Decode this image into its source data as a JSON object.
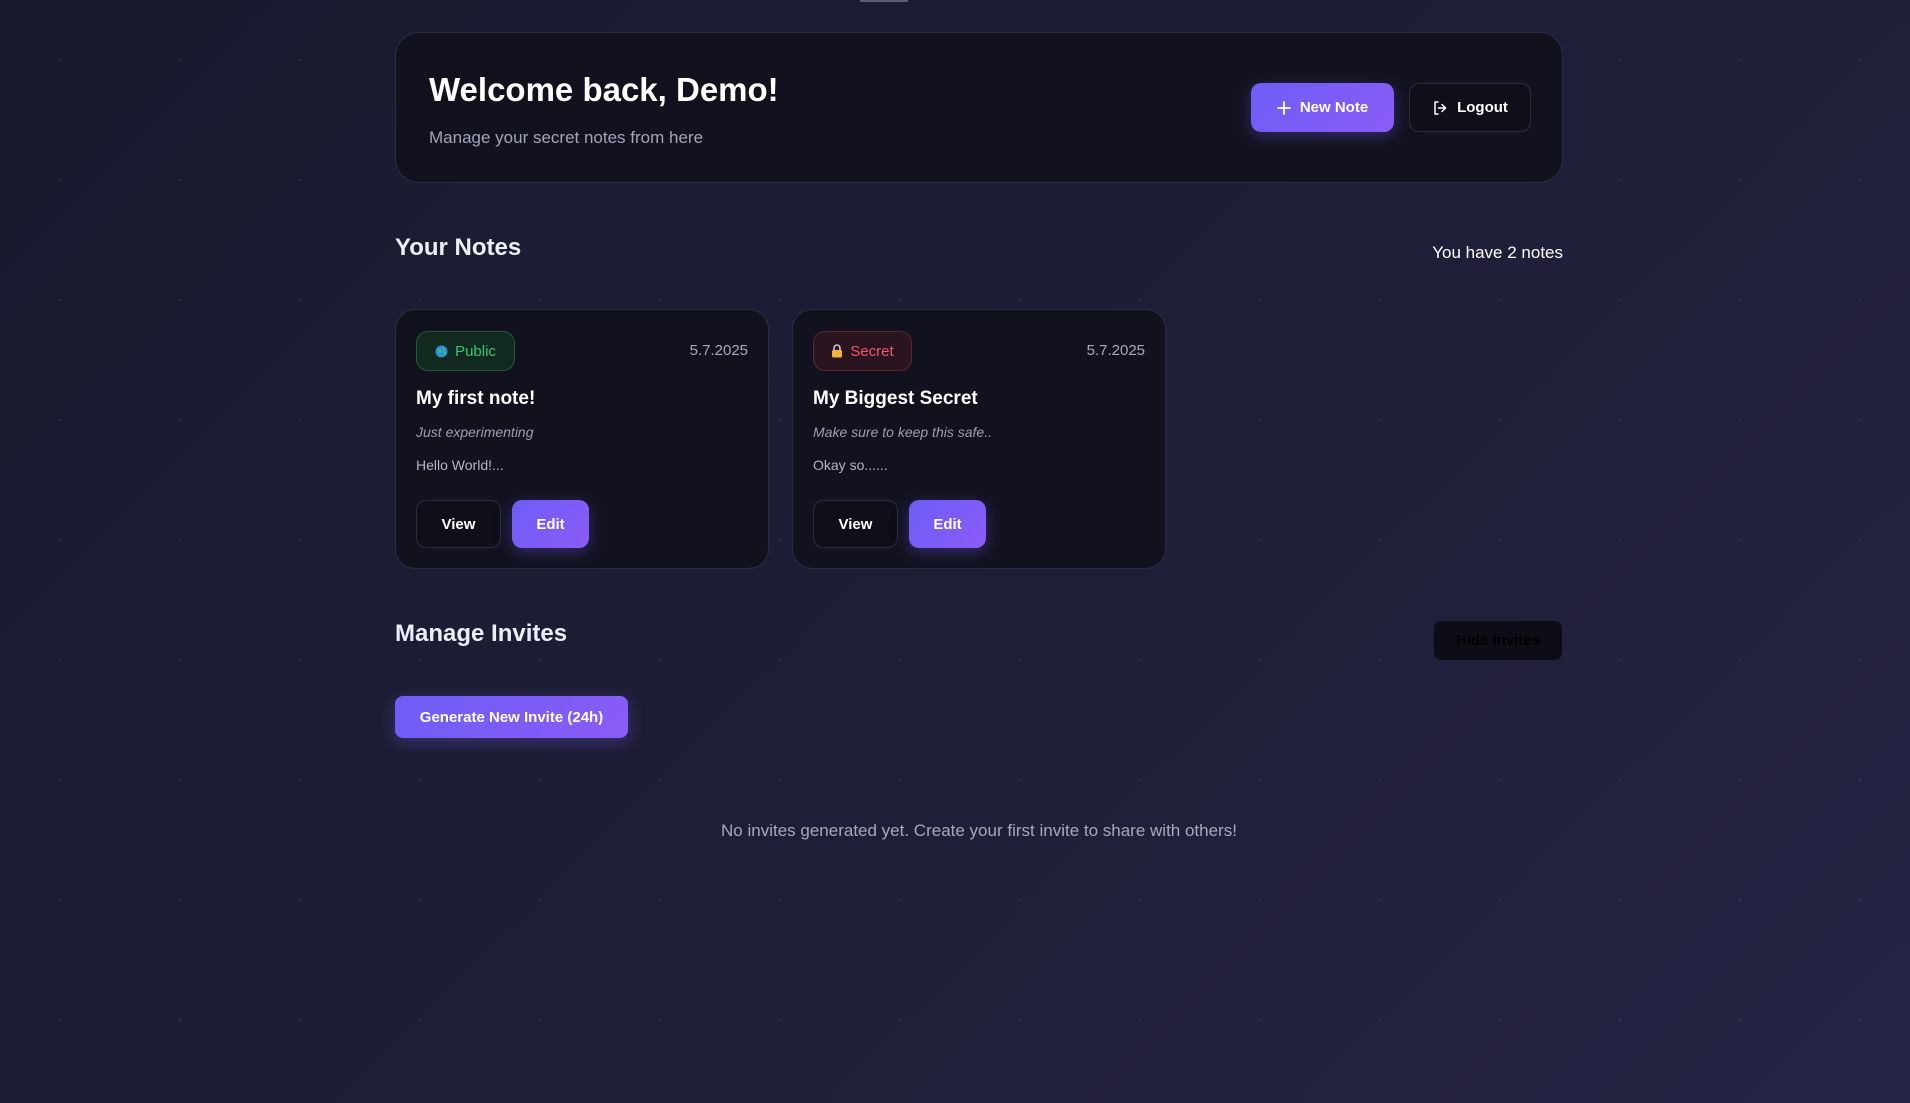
{
  "header": {
    "title": "Welcome back, Demo!",
    "subtitle": "Manage your secret notes from here",
    "new_note_label": "New Note",
    "logout_label": "Logout"
  },
  "notes_section": {
    "title": "Your Notes",
    "count_text": "You have 2 notes"
  },
  "notes": [
    {
      "visibility": "Public",
      "date": "5.7.2025",
      "title": "My first note!",
      "description": "Just experimenting",
      "body": "Hello World!...",
      "view_label": "View",
      "edit_label": "Edit"
    },
    {
      "visibility": "Secret",
      "date": "5.7.2025",
      "title": "My Biggest Secret",
      "description": "Make sure to keep this safe..",
      "body": "Okay so......",
      "view_label": "View",
      "edit_label": "Edit"
    }
  ],
  "invites_section": {
    "title": "Manage Invites",
    "hide_label": "Hide Invites",
    "generate_label": "Generate New Invite (24h)",
    "empty_message": "No invites generated yet. Create your first invite to share with others!"
  },
  "colors": {
    "accent": "#6d5df6",
    "public": "#34c77b",
    "secret": "#f0576b"
  },
  "icons": {
    "new_note": "plus-icon",
    "logout": "logout-icon",
    "public": "globe-icon",
    "secret": "lock-icon"
  }
}
